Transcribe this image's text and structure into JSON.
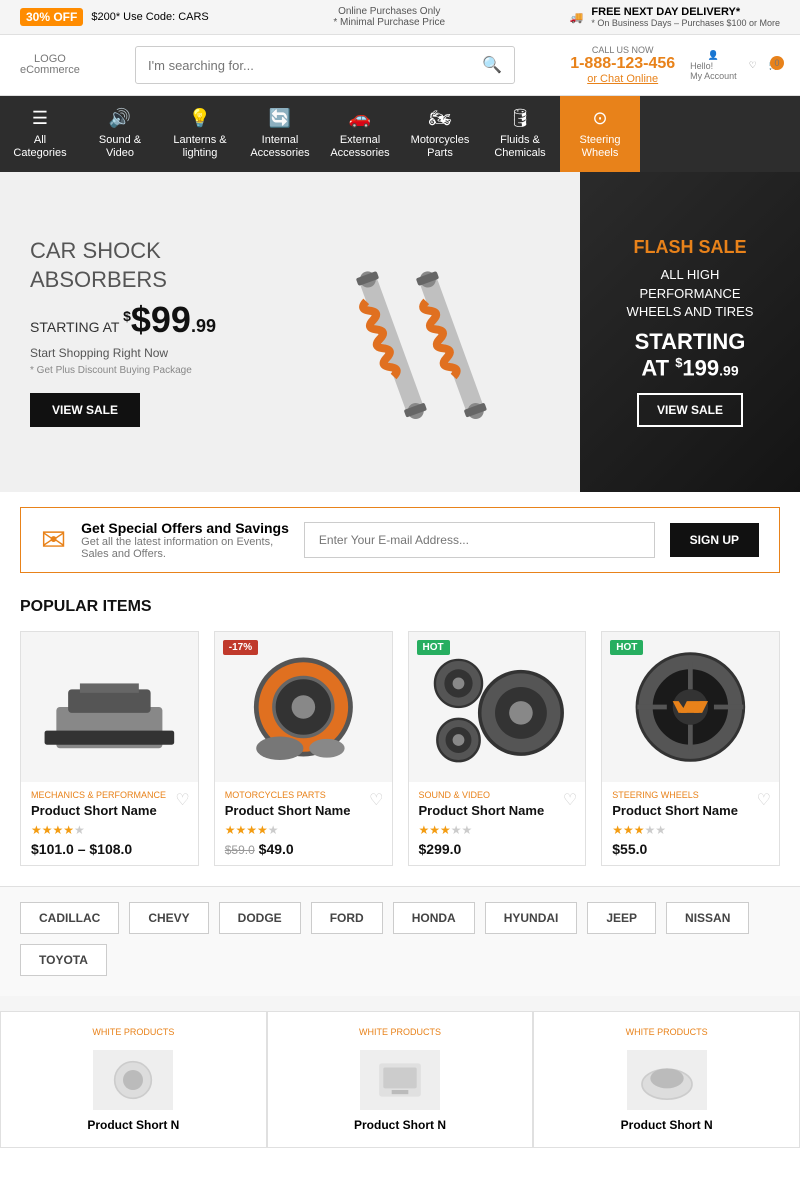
{
  "promoBar": {
    "badge": "30% OFF",
    "promo1": "$200* Use Code: CARS",
    "center1": "Online Purchases Only",
    "center2": "* Minimal Purchase Price",
    "delivery": "FREE NEXT DAY DELIVERY*",
    "deliverySub": "* On Business Days – Purchases $100 or More"
  },
  "header": {
    "logo": "LOGO",
    "logoSub": "eCommerce",
    "searchPlaceholder": "I'm searching for...",
    "callLabel": "CALL US NOW",
    "callNumber": "1-888-123-456",
    "callChat": "or Chat Online",
    "helloLabel": "Hello!",
    "accountLabel": "My Account",
    "cartCount": "0"
  },
  "nav": {
    "items": [
      {
        "label": "All\nCategories",
        "icon": "☰"
      },
      {
        "label": "Sound &\nVideo",
        "icon": "🔊"
      },
      {
        "label": "Lanterns &\nlighting",
        "icon": "💡"
      },
      {
        "label": "Internal\nAccessories",
        "icon": "🔄"
      },
      {
        "label": "External\nAccessories",
        "icon": "🚗"
      },
      {
        "label": "Motorcycles\nParts",
        "icon": "🏍"
      },
      {
        "label": "Fluids &\nChemicals",
        "icon": "🛢"
      },
      {
        "label": "Steering\nWheels",
        "icon": "🎯",
        "active": true
      }
    ]
  },
  "heroLeft": {
    "subtitle": "CAR SHOCK\nABSORBERS",
    "priceLabel": "STARTING AT",
    "priceDollar": "$99",
    "priceCents": ".99",
    "shopText": "Start Shopping Right Now",
    "note": "* Get Plus Discount Buying Package",
    "btnLabel": "VIEW SALE"
  },
  "heroRight": {
    "flashLabel": "FLASH SALE",
    "description": "ALL HIGH\nPERFORMANCE\nWHEELS AND TIRES",
    "priceLabel": "STARTING\nAT",
    "priceDollar": "$199",
    "priceCents": ".99",
    "btnLabel": "VIEW SALE"
  },
  "emailSignup": {
    "title": "Get Special Offers and Savings",
    "sub": "Get all the latest information on Events,\nSales and Offers.",
    "placeholder": "Enter Your E-mail Address...",
    "btnLabel": "SIGN UP"
  },
  "popularItems": {
    "title": "POPULAR ITEMS",
    "products": [
      {
        "badge": "",
        "badgeType": "",
        "category": "MECHANICS & PERFORMANCE",
        "name": "Product Short Name",
        "stars": 4,
        "priceRange": "$101.0 – $108.0",
        "oldPrice": ""
      },
      {
        "badge": "-17%",
        "badgeType": "discount",
        "category": "MOTORCYCLES PARTS",
        "name": "Product Short Name",
        "stars": 4,
        "oldPrice": "$59.0",
        "priceRange": "$49.0"
      },
      {
        "badge": "HOT",
        "badgeType": "hot",
        "category": "SOUND & VIDEO",
        "name": "Product Short Name",
        "stars": 3,
        "priceRange": "$299.0",
        "oldPrice": ""
      },
      {
        "badge": "HOT",
        "badgeType": "hot",
        "category": "STEERING WHEELS",
        "name": "Product Short Name",
        "stars": 3,
        "priceRange": "$55.0",
        "oldPrice": ""
      }
    ]
  },
  "brands": {
    "items": [
      "CADILLAC",
      "CHEVY",
      "DODGE",
      "FORD",
      "HONDA",
      "HYUNDAI",
      "JEEP",
      "NISSAN",
      "TOYOTA"
    ]
  },
  "bottomProducts": {
    "items": [
      {
        "label": "WHITE PRODUCTS",
        "name": "Product Short N"
      },
      {
        "label": "WHITE PRODUCTS",
        "name": "Product Short N"
      },
      {
        "label": "WHITE PRODUCTS",
        "name": "Product Short N"
      }
    ]
  }
}
